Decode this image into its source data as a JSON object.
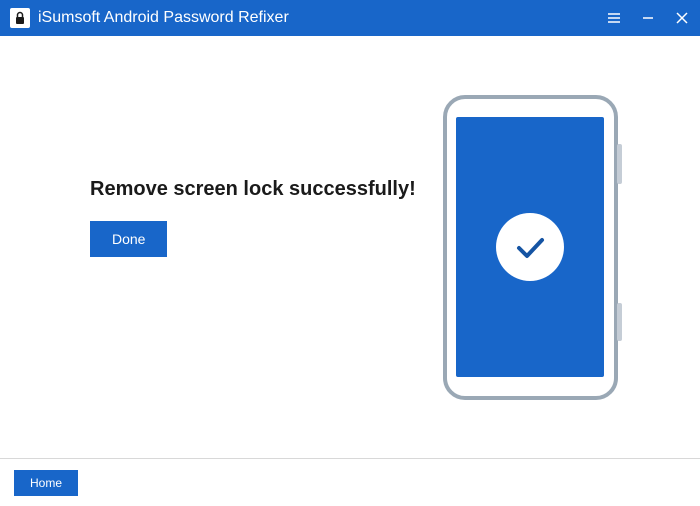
{
  "titlebar": {
    "title": "iSumsoft Android Password Refixer"
  },
  "main": {
    "heading": "Remove screen lock successfully!",
    "done_label": "Done"
  },
  "footer": {
    "home_label": "Home"
  }
}
